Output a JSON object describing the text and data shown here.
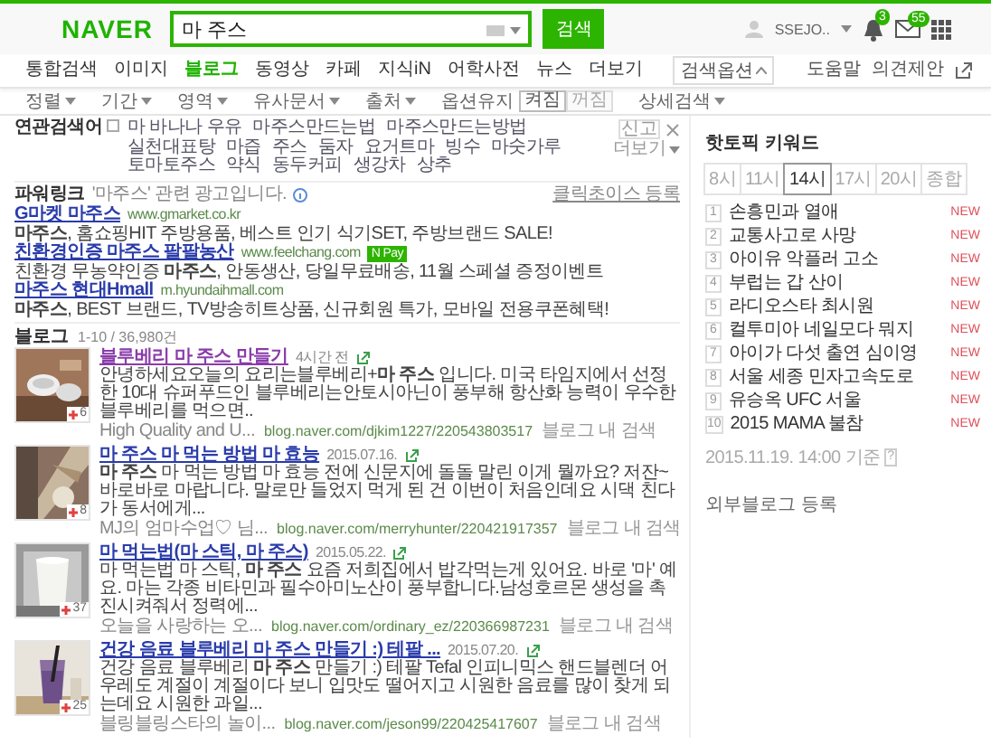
{
  "header": {
    "logo": "NAVER",
    "search": {
      "value": "마 주스"
    },
    "search_button": "검색",
    "user": "SSEJO..",
    "notifications": "3",
    "mail": "55"
  },
  "tabs": [
    {
      "label": "통합검색",
      "selected": false
    },
    {
      "label": "이미지",
      "selected": false
    },
    {
      "label": "블로그",
      "selected": true
    },
    {
      "label": "동영상",
      "selected": false
    },
    {
      "label": "카페",
      "selected": false
    },
    {
      "label": "지식iN",
      "selected": false
    },
    {
      "label": "어학사전",
      "selected": false
    },
    {
      "label": "뉴스",
      "selected": false
    },
    {
      "label": "더보기",
      "selected": false
    }
  ],
  "search_options": "검색옵션",
  "help": "도움말",
  "feedback": "의견제안",
  "filters": [
    {
      "label": "정렬"
    },
    {
      "label": "기간"
    },
    {
      "label": "영역"
    },
    {
      "label": "유사문서"
    },
    {
      "label": "출처"
    }
  ],
  "option_keep": {
    "label": "옵션유지",
    "choices": [
      {
        "label": "켜짐",
        "selected": true
      },
      {
        "label": "꺼짐",
        "selected": false
      }
    ]
  },
  "detail_search": "상세검색",
  "related": {
    "title": "연관검색어",
    "keywords": [
      "마 바나나 우유",
      "마주스만드는법",
      "마주스만드는방법",
      "실천대표탕",
      "마즙",
      "주스",
      "둠자",
      "요거트마",
      "빙수",
      "마숫가루",
      "토마토주스",
      "약식",
      "동두커피",
      "생강차",
      "상추"
    ],
    "report": "신고",
    "more": "더보기"
  },
  "power_link": {
    "title": "파워링크",
    "note": "'마주스' 관련 광고입니다.",
    "register": "클릭초이스 등록",
    "ads": [
      {
        "title": "G마켓 마주스",
        "url": "www.gmarket.co.kr",
        "description": "**마주스**, 홈쇼핑HIT 주방용품, 베스트 인기 식기SET, 주방브랜드 SALE!"
      },
      {
        "title": "친환경인증 마주스 팔팔농산",
        "url": "www.feelchang.com",
        "badge": "N Pay",
        "description": "친환경 무농약인증 **마주스**, 안동생산, 당일무료배송, 11월 스페셜 증정이벤트"
      },
      {
        "title": "마주스 현대Hmall",
        "url": "m.hyundaihmall.com",
        "description": "**마주스**, BEST 브랜드, TV방송히트상품, 신규회원 특가, 모바일 전용쿠폰혜택!"
      }
    ]
  },
  "blog": {
    "title": "블로그",
    "count": "1-10 / 36,980건",
    "posts": [
      {
        "title": "블루베리 마 주스 만들기",
        "visited": true,
        "date": "4시간 전",
        "description": "안녕하세요오늘의 요리는블루베리+**마 주스** 입니다. 미국 타임지에서 선정한 10대 슈퍼푸드인 블루베리는안토시아닌이 풍부해 항산화 능력이 우수한 블루베리를 먹으면..",
        "author": "High Quality and U...",
        "url": "blog.naver.com/djkim1227/220543803517",
        "search_link": "블로그 내 검색",
        "likes": "6"
      },
      {
        "title": "마 주스 마 먹는 방법 마 효능",
        "visited": false,
        "date": "2015.07.16.",
        "description": "**마 주스** 마 먹는 방법 마 효능 전에 신문지에 돌돌 말린 이게 뭘까요? 저잔~바로바로 마랍니다. 말로만 들었지 먹게 된 건 이번이 처음인데요 시댁 친다가 동서에게...",
        "author": "MJ의 엄마수업♡ 님...",
        "url": "blog.naver.com/merryhunter/220421917357",
        "search_link": "블로그 내 검색",
        "likes": "8"
      },
      {
        "title": "마 먹는법(마 스틱, 마 주스)",
        "visited": false,
        "date": "2015.05.22.",
        "description": "마 먹는법 마 스틱, **마 주스** 요즘 저희집에서 밥각먹는게 있어요. 바로 '마' 예요. 마는 각종 비타민과 필수아미노산이 풍부합니다.남성호르몬 생성을 촉진시켜줘서 정력에...",
        "author": "오늘을 사랑하는 오...",
        "url": "blog.naver.com/ordinary_ez/220366987231",
        "search_link": "블로그 내 검색",
        "likes": "37"
      },
      {
        "title": "건강 음료 블루베리 마 주스 만들기 :) 테팔 ...",
        "visited": false,
        "date": "2015.07.20.",
        "description": "건강 음료 블루베리 **마 주스** 만들기 :) 테팔 Tefal 인피니믹스 핸드블렌더 어우레도 계절이 계절이다 보니 입맛도 떨어지고 시원한 음료를 많이 찾게 되는데요 시원한 과일...",
        "author": "블링블링스타의 놀이...",
        "url": "blog.naver.com/jeson99/220425417607",
        "search_link": "블로그 내 검색",
        "likes": "25"
      }
    ]
  },
  "hot_topics": {
    "title": "핫토픽 키워드",
    "tabs": [
      {
        "label": "8시",
        "selected": false
      },
      {
        "label": "11시",
        "selected": false
      },
      {
        "label": "14시",
        "selected": true
      },
      {
        "label": "17시",
        "selected": false
      },
      {
        "label": "20시",
        "selected": false
      },
      {
        "label": "종합",
        "selected": false
      }
    ],
    "keywords": [
      {
        "rank": "1",
        "text": "손흥민과 열애",
        "badge": "NEW"
      },
      {
        "rank": "2",
        "text": "교통사고로 사망",
        "badge": "NEW"
      },
      {
        "rank": "3",
        "text": "아이유 악플러 고소",
        "badge": "NEW"
      },
      {
        "rank": "4",
        "text": "부럽는 갑 산이",
        "badge": "NEW"
      },
      {
        "rank": "5",
        "text": "라디오스타 최시원",
        "badge": "NEW"
      },
      {
        "rank": "6",
        "text": "컬투미아 네일모다 뭐지",
        "badge": "NEW"
      },
      {
        "rank": "7",
        "text": "아이가 다섯 출연 심이영",
        "badge": "NEW"
      },
      {
        "rank": "8",
        "text": "서울 세종 민자고속도로",
        "badge": "NEW"
      },
      {
        "rank": "9",
        "text": "유승옥 UFC 서울",
        "badge": "NEW"
      },
      {
        "rank": "10",
        "text": "2015 MAMA 불참",
        "badge": "NEW"
      }
    ],
    "updated": "2015.11.19. 14:00 기준",
    "help": "?"
  },
  "external_blog": "외부블로그 등록"
}
